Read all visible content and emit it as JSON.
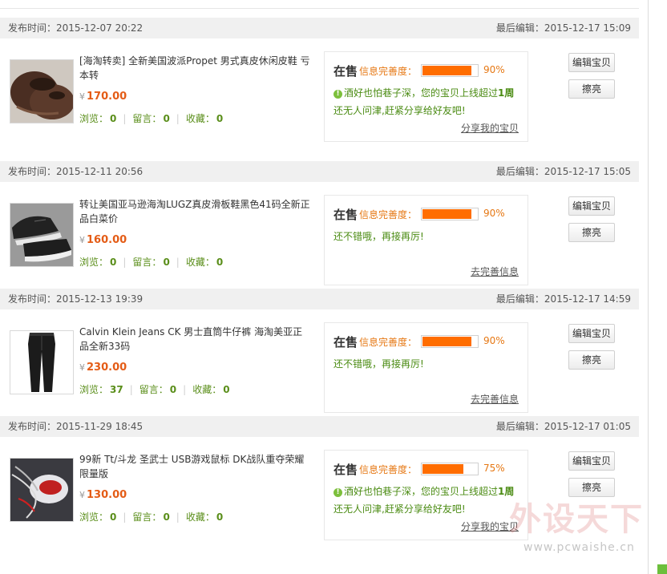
{
  "labels": {
    "published": "发布时间：",
    "last_edited": "最后编辑：",
    "status": "在售",
    "completeness": "信息完善度：",
    "views": "浏览：",
    "comments": "留言：",
    "favorites": "收藏：",
    "yen": "¥",
    "edit_button": "编辑宝贝",
    "polish_button": "擦亮"
  },
  "colors": {
    "accent_orange": "#ff6d00",
    "price_red": "#e45c16",
    "stat_green": "#5a8e1a"
  },
  "listings": [
    {
      "published_time": "2015-12-07 20:22",
      "last_edited_time": "2015-12-17 15:09",
      "title": "[海淘转卖] 全新美国波派Propet 男式真皮休闲皮鞋 亏本转",
      "price": "170.00",
      "views": "0",
      "comments": "0",
      "favorites": "0",
      "completeness_pct": 90,
      "completeness_text": "90%",
      "tip_text": "酒好也怕巷子深，您的宝贝上线超过",
      "tip_bold": "1周",
      "tip_line2": "还无人问津,赶紧分享给好友吧!",
      "link_text": "分享我的宝贝",
      "thumb_icon": "brown-leather-shoes-photo"
    },
    {
      "published_time": "2015-12-11 20:56",
      "last_edited_time": "2015-12-17 15:05",
      "title": "转让美国亚马逊海淘LUGZ真皮滑板鞋黑色41码全新正品白菜价",
      "price": "160.00",
      "views": "0",
      "comments": "0",
      "favorites": "0",
      "completeness_pct": 90,
      "completeness_text": "90%",
      "tip_text": "还不错哦，再接再厉!",
      "link_text": "去完善信息",
      "thumb_icon": "black-sneakers-photo"
    },
    {
      "published_time": "2015-12-13 19:39",
      "last_edited_time": "2015-12-17 14:59",
      "title": "Calvin Klein Jeans CK 男士直筒牛仔裤 海淘美亚正品全新33码",
      "price": "230.00",
      "views": "37",
      "comments": "0",
      "favorites": "0",
      "completeness_pct": 90,
      "completeness_text": "90%",
      "tip_text": "还不错哦，再接再厉!",
      "link_text": "去完善信息",
      "thumb_icon": "black-jeans-photo"
    },
    {
      "published_time": "2015-11-29 18:45",
      "last_edited_time": "2015-12-17 01:05",
      "title": "99新 Tt/斗龙 圣武士 USB游戏鼠标 DK战队重夺荣耀限量版",
      "price": "130.00",
      "views": "0",
      "comments": "0",
      "favorites": "0",
      "completeness_pct": 75,
      "completeness_text": "75%",
      "tip_text": "酒好也怕巷子深，您的宝贝上线超过",
      "tip_bold": "1周",
      "tip_line2": "还无人问津,赶紧分享给好友吧!",
      "link_text": "分享我的宝贝",
      "thumb_icon": "gaming-mouse-photo"
    }
  ],
  "watermark": {
    "text": "外设天下",
    "url": "www.pcwaishe.cn"
  }
}
